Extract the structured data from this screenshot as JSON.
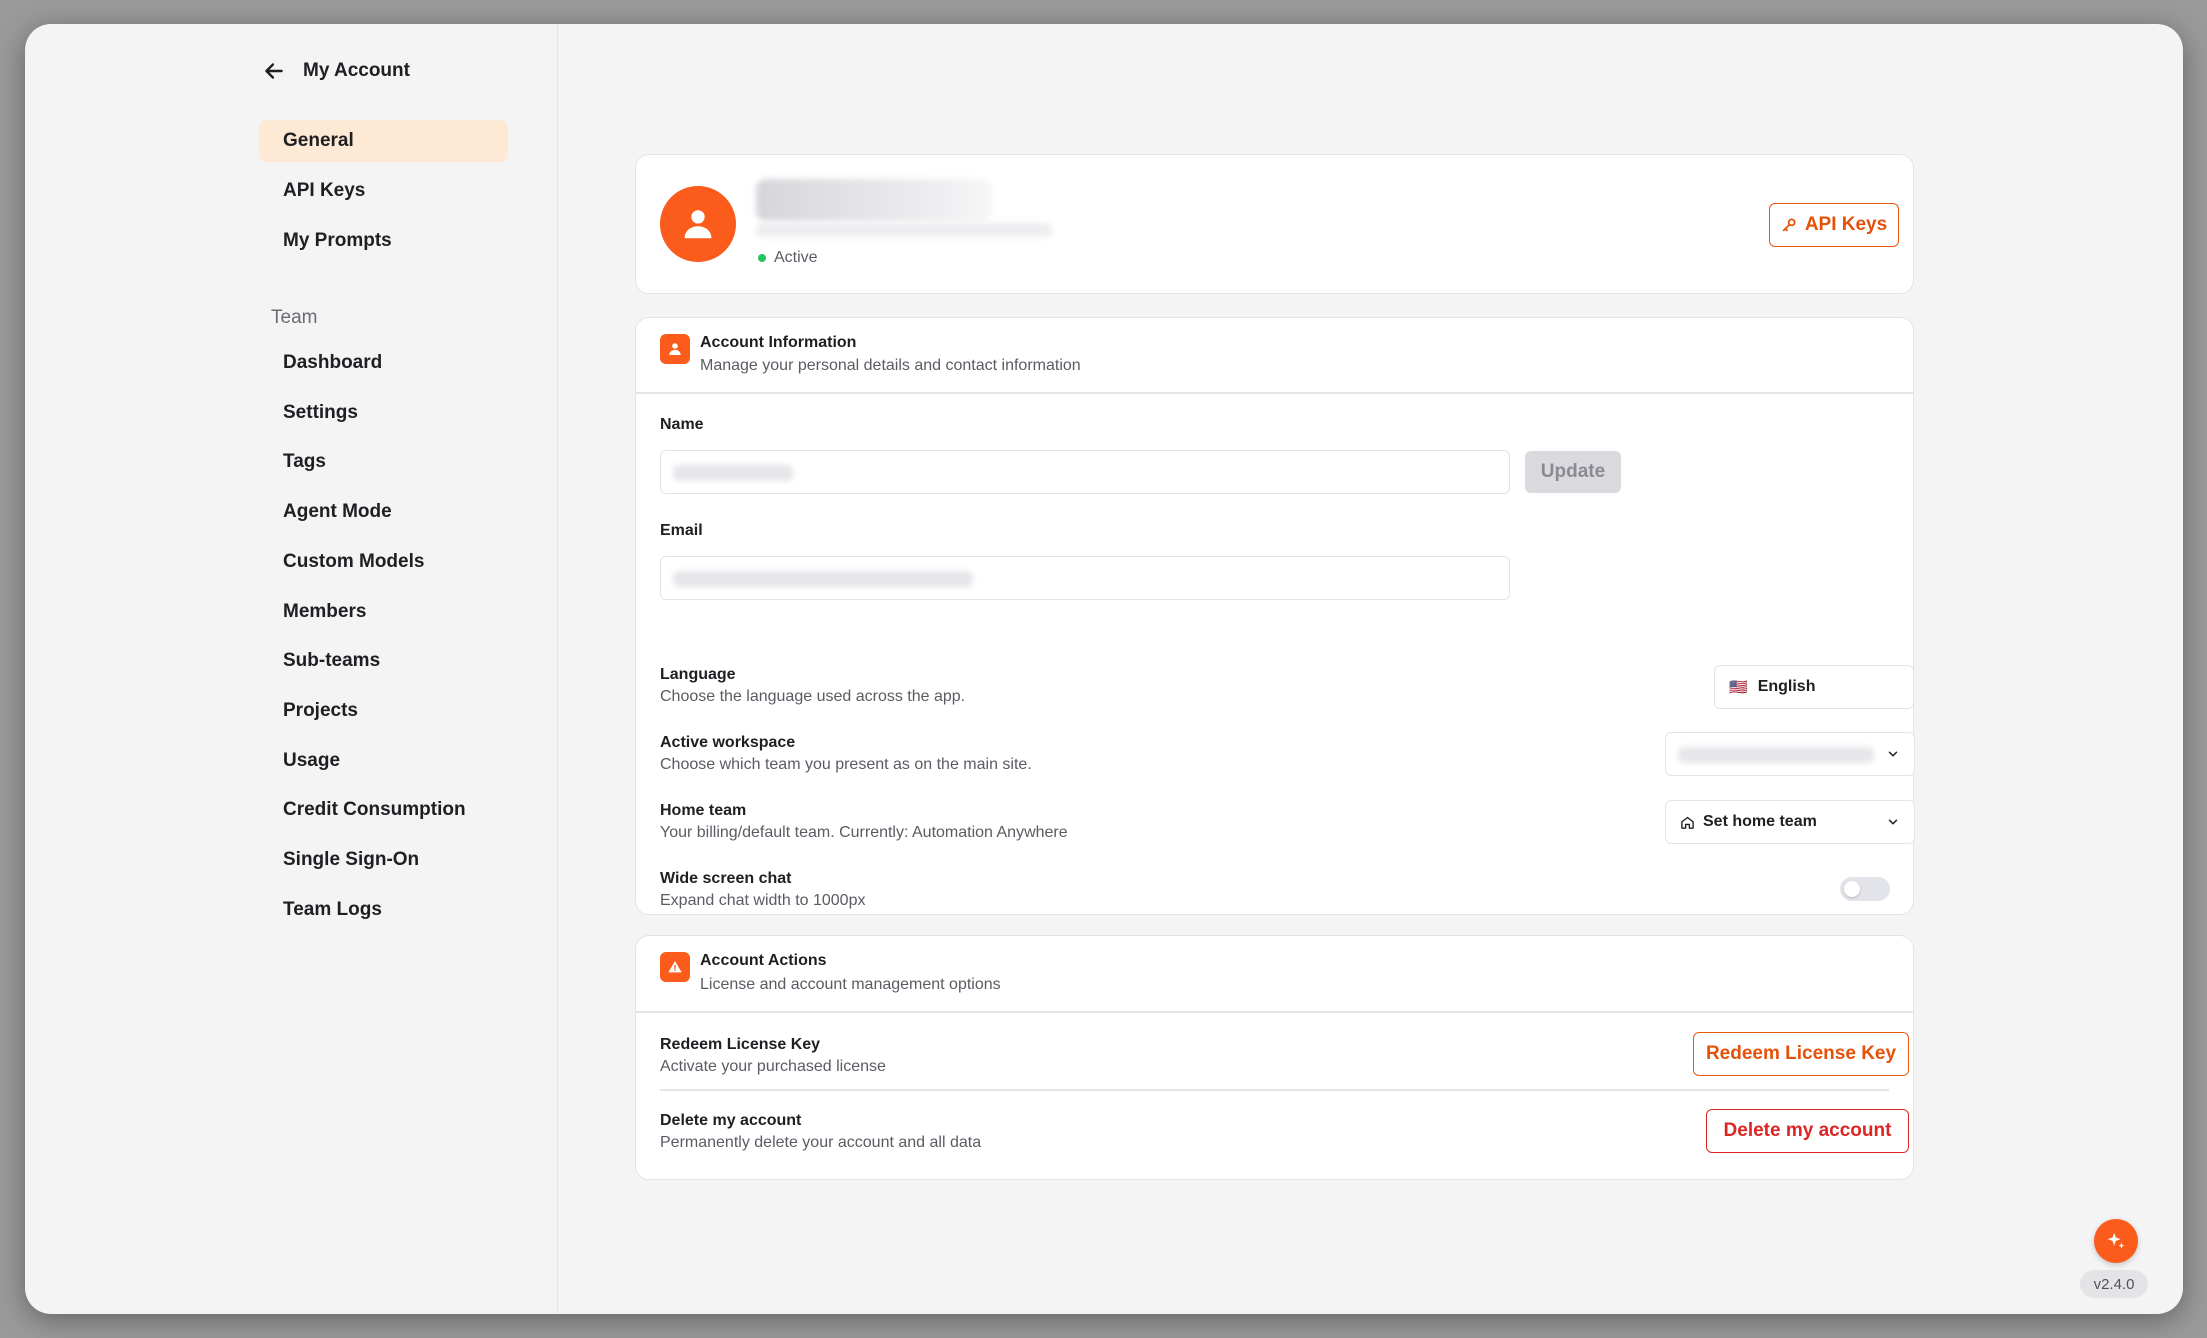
{
  "header": {
    "title": "My Account",
    "back_icon": "arrow-left-icon"
  },
  "sidebar": {
    "account_items": [
      {
        "label": "General",
        "active": true
      },
      {
        "label": "API Keys"
      },
      {
        "label": "My Prompts"
      }
    ],
    "team_section_label": "Team",
    "team_items": [
      {
        "label": "Dashboard"
      },
      {
        "label": "Settings"
      },
      {
        "label": "Tags"
      },
      {
        "label": "Agent Mode"
      },
      {
        "label": "Custom Models"
      },
      {
        "label": "Members"
      },
      {
        "label": "Sub-teams"
      },
      {
        "label": "Projects"
      },
      {
        "label": "Usage"
      },
      {
        "label": "Credit Consumption"
      },
      {
        "label": "Single Sign-On"
      },
      {
        "label": "Team Logs"
      }
    ]
  },
  "profile": {
    "status": "Active",
    "api_keys_button": "API Keys"
  },
  "account_information": {
    "title": "Account Information",
    "subtitle": "Manage your personal details and contact information",
    "name_label": "Name",
    "update_button": "Update",
    "email_label": "Email",
    "language": {
      "label": "Language",
      "description": "Choose the language used across the app.",
      "value": "English",
      "flag": "🇺🇸"
    },
    "active_workspace": {
      "label": "Active workspace",
      "description": "Choose which team you present as on the main site."
    },
    "home_team": {
      "label": "Home team",
      "description": "Your billing/default team. Currently: Automation Anywhere",
      "value": "Set home team"
    },
    "wide_screen_chat": {
      "label": "Wide screen chat",
      "description": "Expand chat width to 1000px",
      "enabled": false
    }
  },
  "account_actions": {
    "title": "Account Actions",
    "subtitle": "License and account management options",
    "redeem": {
      "label": "Redeem License Key",
      "description": "Activate your purchased license",
      "button": "Redeem License Key"
    },
    "delete": {
      "label": "Delete my account",
      "description": "Permanently delete your account and all data",
      "button": "Delete my account"
    }
  },
  "footer": {
    "version": "v2.4.0"
  },
  "colors": {
    "accent": "#fb5b1b",
    "active_nav_bg": "#fde9d4",
    "danger": "#dc2626",
    "status_active": "#22c55e"
  }
}
